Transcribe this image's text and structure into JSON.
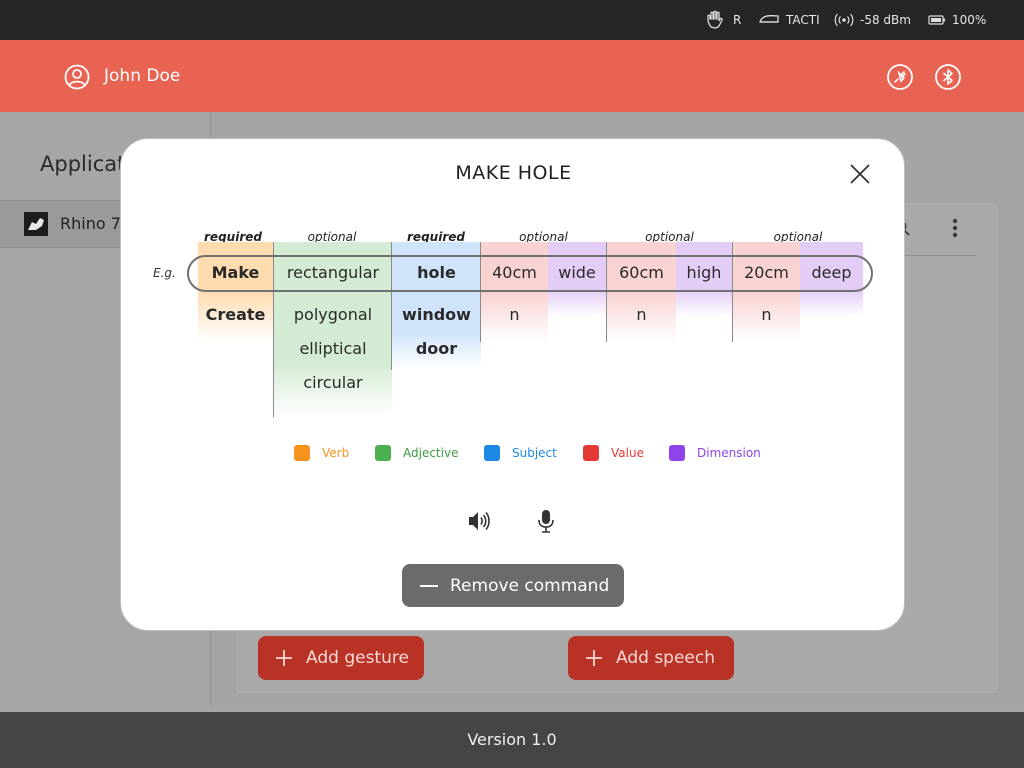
{
  "status_bar": {
    "hand_side": "R",
    "device": "TACTI",
    "signal": "-58 dBm",
    "battery": "100%",
    "icons": [
      "hand-icon",
      "device-icon",
      "signal-icon",
      "battery-icon"
    ]
  },
  "header": {
    "user_name": "John Doe",
    "icons": [
      "user-icon",
      "plug-icon",
      "bluetooth-icon"
    ]
  },
  "sidebar": {
    "title": "Applications",
    "items": [
      {
        "label": "Rhino 7",
        "icon": "rhino-icon"
      }
    ]
  },
  "main": {
    "add_gesture_label": "Add gesture",
    "add_speech_label": "Add speech"
  },
  "modal": {
    "title": "MAKE HOLE",
    "example_label": "E.g.",
    "groups": [
      {
        "label": "required"
      },
      {
        "label": "optional"
      },
      {
        "label": "required"
      },
      {
        "label": "optional"
      },
      {
        "label": "optional"
      },
      {
        "label": "optional"
      }
    ],
    "columns": [
      {
        "type": "verb",
        "example": "Make",
        "options": [
          "Create"
        ]
      },
      {
        "type": "adjective",
        "example": "rectangular",
        "options": [
          "polygonal",
          "elliptical",
          "circular"
        ]
      },
      {
        "type": "subject",
        "example": "hole",
        "options": [
          "window",
          "door"
        ]
      },
      {
        "type": "value",
        "example": "40cm",
        "options": [
          "n"
        ]
      },
      {
        "type": "dimension",
        "example": "wide",
        "options": []
      },
      {
        "type": "value",
        "example": "60cm",
        "options": [
          "n"
        ]
      },
      {
        "type": "dimension",
        "example": "high",
        "options": []
      },
      {
        "type": "value",
        "example": "20cm",
        "options": [
          "n"
        ]
      },
      {
        "type": "dimension",
        "example": "deep",
        "options": []
      }
    ],
    "legend": [
      {
        "label": "Verb",
        "color": "#f7931e"
      },
      {
        "label": "Adjective",
        "color": "#4caf50"
      },
      {
        "label": "Subject",
        "color": "#1e88e5"
      },
      {
        "label": "Value",
        "color": "#e53935"
      },
      {
        "label": "Dimension",
        "color": "#8e44e8"
      }
    ],
    "remove_label": "Remove command",
    "icons": [
      "close-icon",
      "speaker-icon",
      "microphone-icon",
      "minus-icon"
    ]
  },
  "footer": {
    "version": "Version 1.0"
  },
  "colors": {
    "header": "#e86352",
    "primary_button": "#b83226",
    "verb_bg": "#ffdcb0",
    "adjective_bg": "#d3ebd3",
    "subject_bg": "#cfe4fa",
    "value_bg": "#f9d2d2",
    "dimension_bg": "#e3cdf7"
  }
}
